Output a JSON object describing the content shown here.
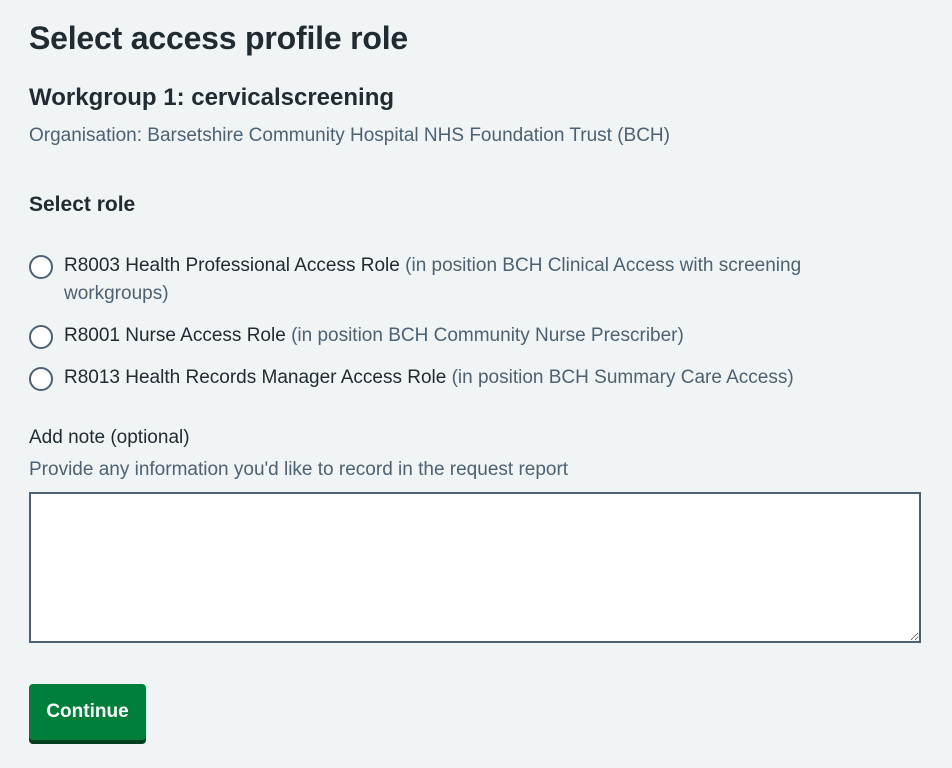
{
  "page": {
    "title": "Select access profile role"
  },
  "workgroup": {
    "title": "Workgroup 1: cervicalscreening",
    "organisation": "Organisation: Barsetshire Community Hospital NHS Foundation Trust (BCH)"
  },
  "role_section": {
    "label": "Select role",
    "options": [
      {
        "role": "R8003 Health Professional Access Role",
        "position": "(in position BCH Clinical Access with screening workgroups)",
        "selected": false
      },
      {
        "role": "R8001 Nurse Access Role",
        "position": "(in position BCH Community Nurse Prescriber)",
        "selected": false
      },
      {
        "role": "R8013 Health Records Manager Access Role",
        "position": "(in position BCH Summary Care Access)",
        "selected": false
      }
    ]
  },
  "note": {
    "label": "Add note (optional)",
    "hint": "Provide any information you'd like to record in the request report",
    "value": ""
  },
  "actions": {
    "continue_label": "Continue"
  },
  "colors": {
    "background": "#f0f4f5",
    "text": "#212b32",
    "secondary_text": "#4c6272",
    "button": "#007f3b",
    "button_shadow": "#00401e"
  }
}
